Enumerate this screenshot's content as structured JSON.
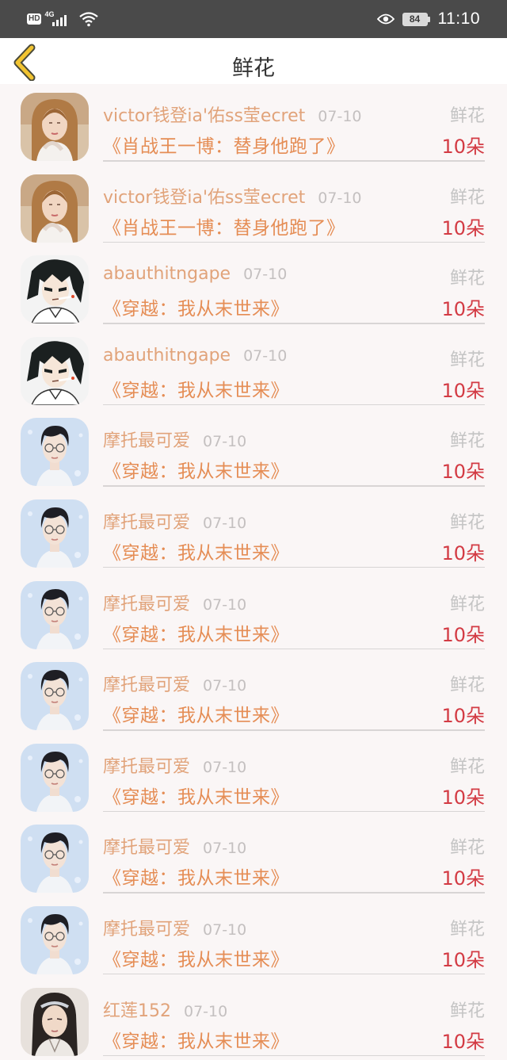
{
  "status_bar": {
    "hd": "HD",
    "network": "4G",
    "battery": "84",
    "time": "11:10",
    "icons": [
      "signal-icon",
      "wifi-icon",
      "eye-icon",
      "battery-icon"
    ]
  },
  "header": {
    "title": "鲜花",
    "back_icon": "chevron-left-icon"
  },
  "colors": {
    "name": "#e1a37a",
    "date": "#c4c0c0",
    "book": "#e58d55",
    "gift_label": "#c4c4c4",
    "count": "#d33b44",
    "back_arrow": "#f2c431"
  },
  "items": [
    {
      "avatar": "girl-avatar",
      "name": "victor钱登ia'佑ss莹ecret",
      "date": "07-10",
      "book": "《肖战王一博：替身他跑了》",
      "gift": "鲜花",
      "count": "10朵"
    },
    {
      "avatar": "girl-avatar",
      "name": "victor钱登ia'佑ss莹ecret",
      "date": "07-10",
      "book": "《肖战王一博：替身他跑了》",
      "gift": "鲜花",
      "count": "10朵"
    },
    {
      "avatar": "anime-boy-avatar",
      "name": "abauthitngape",
      "date": "07-10",
      "book": "《穿越：我从末世来》",
      "gift": "鲜花",
      "count": "10朵"
    },
    {
      "avatar": "anime-boy-avatar",
      "name": "abauthitngape",
      "date": "07-10",
      "book": "《穿越：我从末世来》",
      "gift": "鲜花",
      "count": "10朵"
    },
    {
      "avatar": "young-man-avatar",
      "name": "摩托最可爱",
      "date": "07-10",
      "book": "《穿越：我从末世来》",
      "gift": "鲜花",
      "count": "10朵"
    },
    {
      "avatar": "young-man-avatar",
      "name": "摩托最可爱",
      "date": "07-10",
      "book": "《穿越：我从末世来》",
      "gift": "鲜花",
      "count": "10朵"
    },
    {
      "avatar": "young-man-avatar",
      "name": "摩托最可爱",
      "date": "07-10",
      "book": "《穿越：我从末世来》",
      "gift": "鲜花",
      "count": "10朵"
    },
    {
      "avatar": "young-man-avatar",
      "name": "摩托最可爱",
      "date": "07-10",
      "book": "《穿越：我从末世来》",
      "gift": "鲜花",
      "count": "10朵"
    },
    {
      "avatar": "young-man-avatar",
      "name": "摩托最可爱",
      "date": "07-10",
      "book": "《穿越：我从末世来》",
      "gift": "鲜花",
      "count": "10朵"
    },
    {
      "avatar": "young-man-avatar",
      "name": "摩托最可爱",
      "date": "07-10",
      "book": "《穿越：我从末世来》",
      "gift": "鲜花",
      "count": "10朵"
    },
    {
      "avatar": "young-man-avatar",
      "name": "摩托最可爱",
      "date": "07-10",
      "book": "《穿越：我从末世来》",
      "gift": "鲜花",
      "count": "10朵"
    },
    {
      "avatar": "costume-man-avatar",
      "name": "红莲152",
      "date": "07-10",
      "book": "《穿越：我从末世来》",
      "gift": "鲜花",
      "count": "10朵"
    }
  ]
}
